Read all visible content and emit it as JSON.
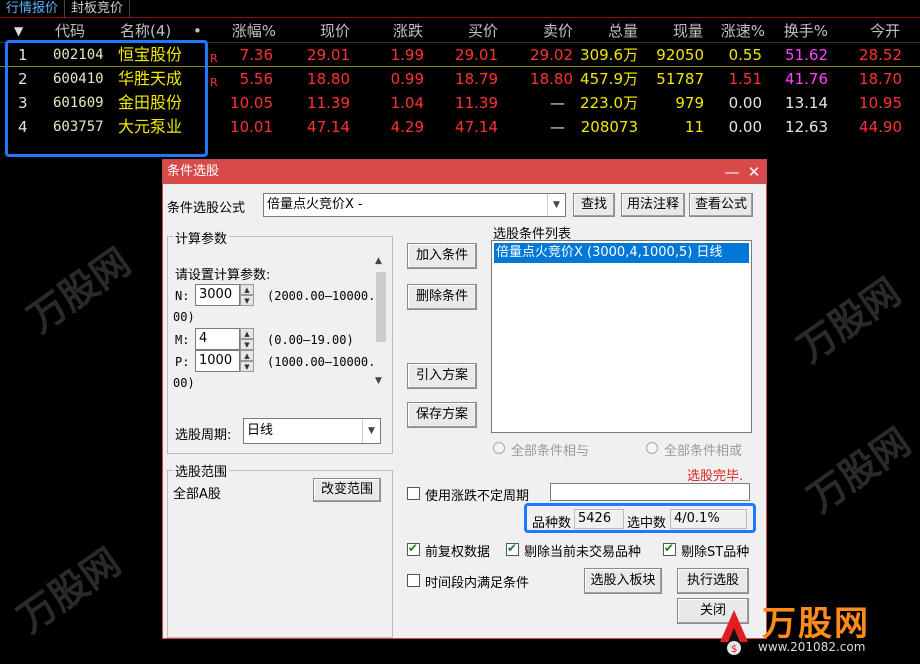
{
  "tabs": [
    {
      "label": "行情报价"
    },
    {
      "label": "封板竞价"
    }
  ],
  "table": {
    "headers": {
      "sort": "▼",
      "code": "代码",
      "name": "名称(4)",
      "dot": "•",
      "chg_pct": "涨幅%",
      "price": "现价",
      "change": "涨跌",
      "bid": "买价",
      "ask": "卖价",
      "volume": "总量",
      "cur_vol": "现量",
      "speed": "涨速%",
      "turnover": "换手%",
      "open": "今开"
    },
    "rows": [
      {
        "num": "1",
        "code": "002104",
        "name": "恒宝股份",
        "tag": "R",
        "chg_pct": "7.36",
        "price": "29.01",
        "change": "1.99",
        "bid": "29.01",
        "ask": "29.02",
        "volume": "309.6万",
        "cur_vol": "92050",
        "speed": "0.55",
        "turnover": "51.62",
        "open": "28.52"
      },
      {
        "num": "2",
        "code": "600410",
        "name": "华胜天成",
        "tag": "R",
        "chg_pct": "5.56",
        "price": "18.80",
        "change": "0.99",
        "bid": "18.79",
        "ask": "18.80",
        "volume": "457.9万",
        "cur_vol": "51787",
        "speed": "1.51",
        "turnover": "41.76",
        "open": "18.70"
      },
      {
        "num": "3",
        "code": "601609",
        "name": "金田股份",
        "tag": "",
        "chg_pct": "10.05",
        "price": "11.39",
        "change": "1.04",
        "bid": "11.39",
        "ask": "—",
        "volume": "223.0万",
        "cur_vol": "979",
        "speed": "0.00",
        "turnover": "13.14",
        "open": "10.95"
      },
      {
        "num": "4",
        "code": "603757",
        "name": "大元泵业",
        "tag": "",
        "chg_pct": "10.01",
        "price": "47.14",
        "change": "4.29",
        "bid": "47.14",
        "ask": "—",
        "volume": "208073",
        "cur_vol": "11",
        "speed": "0.00",
        "turnover": "12.63",
        "open": "44.90"
      }
    ]
  },
  "dialog": {
    "title": "条件选股",
    "minimize": "—",
    "close": "✕",
    "formula_label": "条件选股公式",
    "formula_value": "倍量点火竞价X  -",
    "btn_find": "查找",
    "btn_usage": "用法注释",
    "btn_view": "查看公式",
    "params_group": "计算参数",
    "params_prompt": "请设置计算参数:",
    "n_label": "N:",
    "n_value": "3000",
    "n_range": "(2000.00—10000.",
    "n_range2": "00)",
    "m_label": "M:",
    "m_value": "4",
    "m_range": "(0.00—19.00)",
    "p_label": "P:",
    "p_value": "1000",
    "p_range": "(1000.00—10000.",
    "p_range2": "00)",
    "period_label": "选股周期:",
    "period_value": "日线",
    "btn_add": "加入条件",
    "btn_delete": "删除条件",
    "btn_import": "引入方案",
    "btn_save": "保存方案",
    "cond_list_label": "选股条件列表",
    "cond_item": "倍量点火竞价X (3000,4,1000,5) 日线",
    "radio_and": "全部条件相与",
    "radio_or": "全部条件相或",
    "status": "选股完毕.",
    "range_group": "选股范围",
    "range_value": "全部A股",
    "btn_change_range": "改变范围",
    "use_uncertain_period": "使用涨跌不定周期",
    "count_label": "品种数",
    "count_value": "5426",
    "selected_label": "选中数",
    "selected_value": "4/0.1%",
    "chk_adjust": "前复权数据",
    "chk_exclude_untraded": "剔除当前未交易品种",
    "chk_exclude_st": "剔除ST品种",
    "chk_time_range": "时间段内满足条件",
    "btn_to_board": "选股入板块",
    "btn_execute": "执行选股",
    "btn_close": "关闭"
  },
  "watermark": {
    "text": "万股网",
    "url": "www.201082.com"
  },
  "logo": {
    "text": "万股网",
    "url": "www.201082.com"
  },
  "colors": {
    "up": "#ff3333",
    "price_yellow": "#f2e800",
    "turnover": "#ff44ff",
    "highlight": "#1f78ff",
    "dialog_title": "#d84a4a"
  }
}
